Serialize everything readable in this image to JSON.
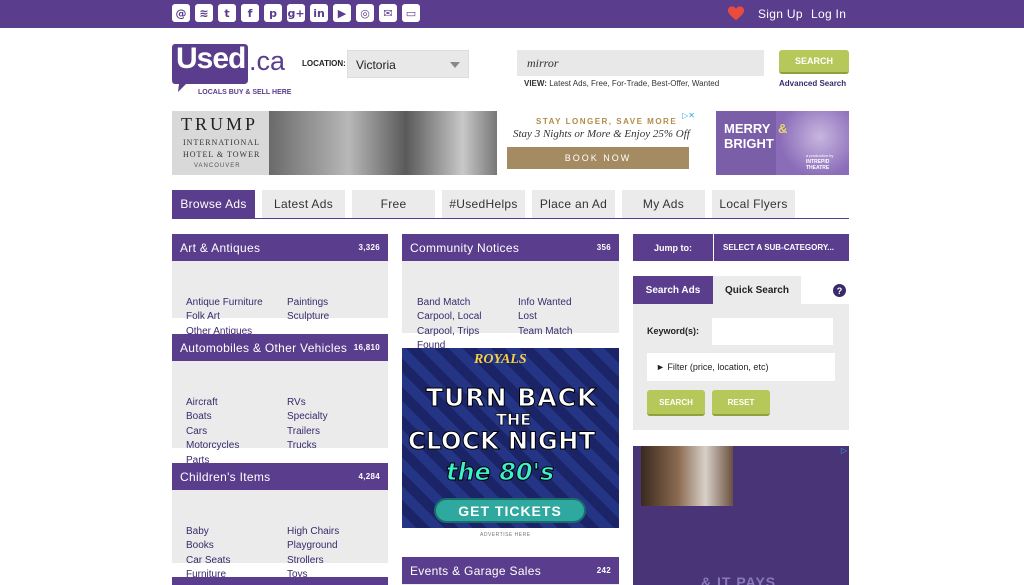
{
  "header": {
    "social_icons": [
      {
        "name": "email",
        "glyph": "@"
      },
      {
        "name": "rss",
        "glyph": "≋"
      },
      {
        "name": "twitter",
        "glyph": "t"
      },
      {
        "name": "facebook",
        "glyph": "f"
      },
      {
        "name": "pinterest",
        "glyph": "p"
      },
      {
        "name": "google-plus",
        "glyph": "g+"
      },
      {
        "name": "linkedin",
        "glyph": "in"
      },
      {
        "name": "youtube",
        "glyph": "▶"
      },
      {
        "name": "instagram",
        "glyph": "◎"
      },
      {
        "name": "mail",
        "glyph": "✉"
      },
      {
        "name": "chat",
        "glyph": "▭"
      }
    ],
    "sign_up": "Sign Up",
    "log_in": "Log In",
    "accent": "#5a3d8c",
    "heart_color": "#e94b3c"
  },
  "brand": {
    "logo_text": "Used",
    "logo_domain": ".ca",
    "tagline": "LOCALS BUY & SELL HERE"
  },
  "location": {
    "label": "LOCATION:",
    "value": "Victoria"
  },
  "search": {
    "value": "mirror",
    "view_label": "VIEW:",
    "view_options": "Latest Ads, Free, For-Trade, Best-Offer, Wanted",
    "button": "SEARCH",
    "advanced": "Advanced Search",
    "button_color": "#b6c85a"
  },
  "ads": {
    "trump_title": "TRUMP",
    "trump_sub1": "INTERNATIONAL",
    "trump_sub2": "HOTEL & TOWER",
    "trump_sub3": "VANCOUVER",
    "trump_headline": "STAY LONGER, SAVE MORE",
    "trump_offer": "Stay 3 Nights or More & Enjoy 25% Off",
    "trump_cta": "BOOK NOW",
    "merry_line1": "MERRY",
    "merry_amp": "&",
    "merry_line2": "BRIGHT",
    "merry_presented": "a production by",
    "merry_theatre": "INTREPID THEATRE",
    "royals_logo": "ROYALS",
    "royals_line1": "TURN BACK",
    "royals_line2": "THE",
    "royals_line3": "CLOCK NIGHT",
    "royals_line4": "the 80's",
    "royals_cta": "GET TICKETS",
    "advertise_here": "ADVERTISE HERE",
    "right_ad_text": "& IT PAYS"
  },
  "tabs": [
    {
      "label": "Browse Ads"
    },
    {
      "label": "Latest Ads"
    },
    {
      "label": "Free"
    },
    {
      "label": "#UsedHelps"
    },
    {
      "label": "Place an Ad"
    },
    {
      "label": "My Ads"
    },
    {
      "label": "Local Flyers"
    }
  ],
  "categories": {
    "art": {
      "title": "Art & Antiques",
      "count": "3,326",
      "col1": [
        "Antique Furniture",
        "Folk Art",
        "Other Antiques"
      ],
      "col2": [
        "Paintings",
        "Sculpture"
      ]
    },
    "auto": {
      "title": "Automobiles & Other Vehicles",
      "count": "16,810",
      "col1": [
        "Aircraft",
        "Boats",
        "Cars",
        "Motorcycles",
        "Parts"
      ],
      "col2": [
        "RVs",
        "Specialty",
        "Trailers",
        "Trucks"
      ]
    },
    "children": {
      "title": "Children's Items",
      "count": "4,284",
      "col1": [
        "Baby",
        "Books",
        "Car Seats",
        "Furniture"
      ],
      "col2": [
        "High Chairs",
        "Playground",
        "Strollers",
        "Toys"
      ]
    },
    "community": {
      "title": "Community Notices",
      "count": "356",
      "col1": [
        "Band Match",
        "Carpool, Local",
        "Carpool, Trips",
        "Found"
      ],
      "col2": [
        "Info Wanted",
        "Lost",
        "Team Match"
      ]
    },
    "events": {
      "title": "Events & Garage Sales",
      "count": "242"
    }
  },
  "sidebar": {
    "jump_label": "Jump to:",
    "jump_select": "SELECT A SUB-CATEGORY...",
    "tab_search": "Search Ads",
    "tab_quick": "Quick Search",
    "help": "?",
    "keywords_label": "Keyword(s):",
    "filter": "► Filter (price, location, etc)",
    "search_btn": "SEARCH",
    "reset_btn": "RESET"
  }
}
